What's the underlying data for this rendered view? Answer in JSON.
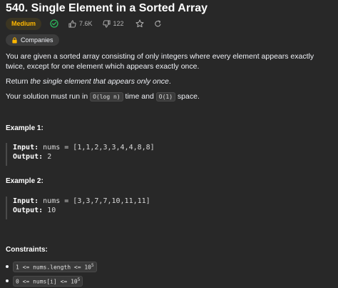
{
  "problem": {
    "title": "540. Single Element in a Sorted Array",
    "difficulty": "Medium",
    "likes": "7.6K",
    "dislikes": "122",
    "companies_label": "Companies"
  },
  "description": {
    "p1": "You are given a sorted array consisting of only integers where every element appears exactly twice, except for one element which appears exactly once.",
    "p2_prefix": "Return ",
    "p2_em": "the single element that appears only once",
    "p2_suffix": ".",
    "p3_prefix": "Your solution must run in ",
    "p3_code1": "O(log n)",
    "p3_mid": " time and ",
    "p3_code2": "O(1)",
    "p3_suffix": " space."
  },
  "examples": [
    {
      "heading": "Example 1:",
      "input_label": "Input:",
      "input_value": "nums = [1,1,2,3,3,4,4,8,8]",
      "output_label": "Output:",
      "output_value": "2"
    },
    {
      "heading": "Example 2:",
      "input_label": "Input:",
      "input_value": "nums = [3,3,7,7,10,11,11]",
      "output_label": "Output:",
      "output_value": "10"
    }
  ],
  "constraints": {
    "heading": "Constraints:",
    "items": [
      {
        "code": "1 <= nums.length <= 10",
        "sup": "5"
      },
      {
        "code": "0 <= nums[i] <= 10",
        "sup": "5"
      }
    ]
  },
  "colors": {
    "background": "#282828",
    "difficulty_medium": "#ffb800",
    "solved_check": "#2cbb5d"
  },
  "icons": [
    "check-circle-icon",
    "thumbs-up-icon",
    "thumbs-down-icon",
    "star-icon",
    "share-icon",
    "lock-icon"
  ]
}
